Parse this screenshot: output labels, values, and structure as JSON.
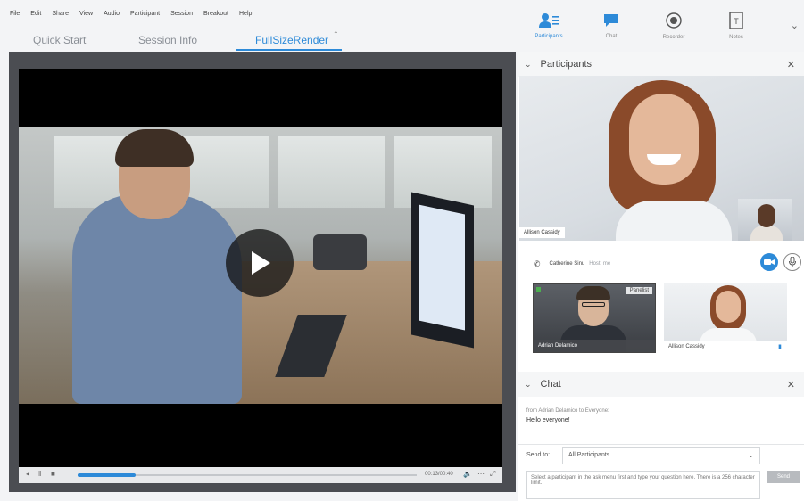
{
  "menu": [
    "File",
    "Edit",
    "Share",
    "View",
    "Audio",
    "Participant",
    "Session",
    "Breakout",
    "Help"
  ],
  "tabs": {
    "quick_start": "Quick Start",
    "session_info": "Session Info",
    "fullsize": "FullSizeRender"
  },
  "toolbar": {
    "participants": "Participants",
    "chat": "Chat",
    "recorder": "Recorder",
    "notes": "Notes"
  },
  "player": {
    "time": "00:13/00:40",
    "progress": 0.17
  },
  "participants_panel": {
    "title": "Participants",
    "main_video_name": "Allison Cassidy",
    "caller_name": "Catherine Sinu",
    "caller_status": "Host, me",
    "thumbs": [
      {
        "name": "Adrian Delamico",
        "badge": "Panelist"
      },
      {
        "name": "Allison Cassidy"
      }
    ]
  },
  "chat_panel": {
    "title": "Chat",
    "from": "from Adrian Delamico to Everyone:",
    "message": "Hello everyone!",
    "send_to_label": "Send to:",
    "recipient": "All Participants",
    "input_placeholder": "Select a participant in the ask menu first and type your question here. There is a 256 character limit.",
    "send_label": "Send"
  },
  "colors": {
    "accent": "#2d8ad8"
  }
}
